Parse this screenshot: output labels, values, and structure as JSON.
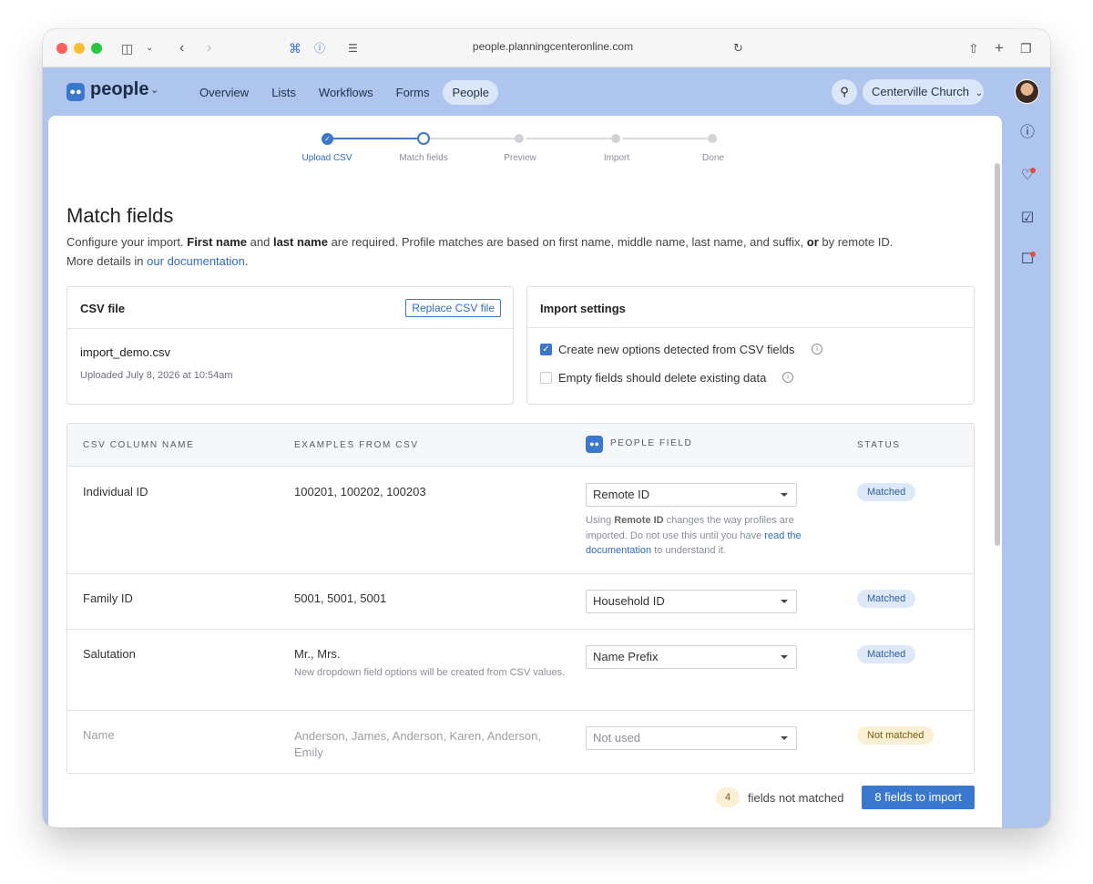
{
  "browser": {
    "url": "people.planningcenteronline.com"
  },
  "app": {
    "logo_text": "people",
    "nav": [
      "Overview",
      "Lists",
      "Workflows",
      "Forms",
      "People"
    ],
    "active_nav": "People",
    "org_name": "Centerville Church"
  },
  "stepper": {
    "steps": [
      "Upload CSV",
      "Match fields",
      "Preview",
      "Import",
      "Done"
    ],
    "current": "Match fields"
  },
  "page": {
    "title": "Match fields",
    "desc_1": "Configure your import.",
    "desc_bold_1": "First name",
    "desc_2": "and",
    "desc_bold_2": "last name",
    "desc_3": "are required. Profile matches are based on first name, middle name, last name, and suffix,",
    "desc_bold_3": "or",
    "desc_4": "by remote ID.",
    "desc_5": "More details in",
    "desc_link": "our documentation",
    "desc_end": "."
  },
  "csv_card": {
    "title": "CSV file",
    "replace_label": "Replace CSV file",
    "file_name": "import_demo.csv",
    "uploaded": "Uploaded July 8, 2026 at 10:54am"
  },
  "settings_card": {
    "title": "Import settings",
    "options": [
      {
        "label": "Create new options detected from CSV fields",
        "checked": true
      },
      {
        "label": "Empty fields should delete existing data",
        "checked": false
      }
    ]
  },
  "table": {
    "headers": [
      "CSV COLUMN NAME",
      "EXAMPLES FROM CSV",
      "PEOPLE FIELD",
      "STATUS"
    ],
    "rows": [
      {
        "column": "Individual ID",
        "examples": "100201, 100202, 100203",
        "field": "Remote ID",
        "status": "Matched",
        "note_1": "Using",
        "note_bold": "Remote ID",
        "note_2": "changes the way profiles are imported. Do not use this until you have",
        "note_link": "read the documentation",
        "note_3": "to understand it."
      },
      {
        "column": "Family ID",
        "examples": "5001, 5001, 5001",
        "field": "Household ID",
        "status": "Matched"
      },
      {
        "column": "Salutation",
        "examples": "Mr., Mrs.",
        "examples_note": "New dropdown field options will be created from CSV values.",
        "field": "Name Prefix",
        "status": "Matched"
      },
      {
        "column": "Name",
        "examples": "Anderson, James, Anderson, Karen, Anderson, Emily",
        "field": "Not used",
        "status": "Not matched"
      }
    ]
  },
  "footer": {
    "unmatched_count": "4",
    "unmatched_label": "fields not matched",
    "import_button": "8 fields to import"
  },
  "colors": {
    "accent": "#3a78cf",
    "window_bg": "#aec6ee",
    "matched_badge": "#dde9f9",
    "unmatched_badge": "#fbf0d4"
  }
}
